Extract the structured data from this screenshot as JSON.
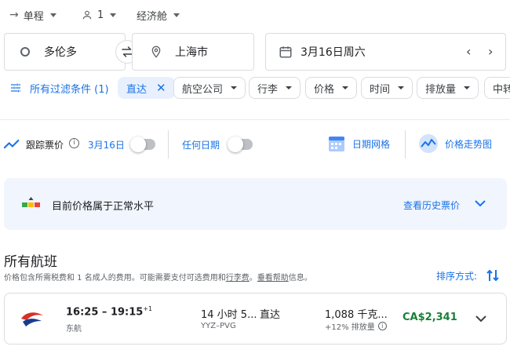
{
  "trip": {
    "type": "单程",
    "passengers": "1",
    "cabin": "经济舱"
  },
  "search": {
    "origin": "多伦多",
    "destination": "上海市",
    "date": "3月16日周六"
  },
  "filters": {
    "all_filters": "所有过滤条件 (1)",
    "chips": [
      {
        "label": "直达",
        "active": true
      },
      {
        "label": "航空公司"
      },
      {
        "label": "行李"
      },
      {
        "label": "价格"
      },
      {
        "label": "时间"
      },
      {
        "label": "排放量"
      },
      {
        "label": "中转"
      }
    ]
  },
  "tracking": {
    "track_label": "跟踪票价",
    "track_date": "3月16日",
    "any_dates": "任何日期",
    "date_grid": "日期网格",
    "price_graph": "价格走势图"
  },
  "insight": {
    "text": "目前价格属于正常水平",
    "history_link": "查看历史票价"
  },
  "results": {
    "heading": "所有航班",
    "note_prefix": "价格包含所需税费和 1 名成人的费用。可能需要支付可选费用和",
    "note_link1": "行李费",
    "note_mid": "。",
    "note_link2": "垂看帮助",
    "note_suffix": "信息。",
    "sort_label": "排序方式:"
  },
  "flights": [
    {
      "depart": "16:25",
      "sep": " – ",
      "arrive": "19:15",
      "day_offset": "+1",
      "airline": "东航",
      "duration": "14 小时 5...",
      "route": "YYZ–PVG",
      "stops": "直达",
      "emissions": "1,088 千克...",
      "emissions_delta": "+12% 排放量",
      "price": "CA$2,341"
    }
  ],
  "colors": {
    "accent": "#1a73e8",
    "price_green": "#188038",
    "airline_red": "#d93025",
    "airline_blue": "#1a3b8f"
  }
}
